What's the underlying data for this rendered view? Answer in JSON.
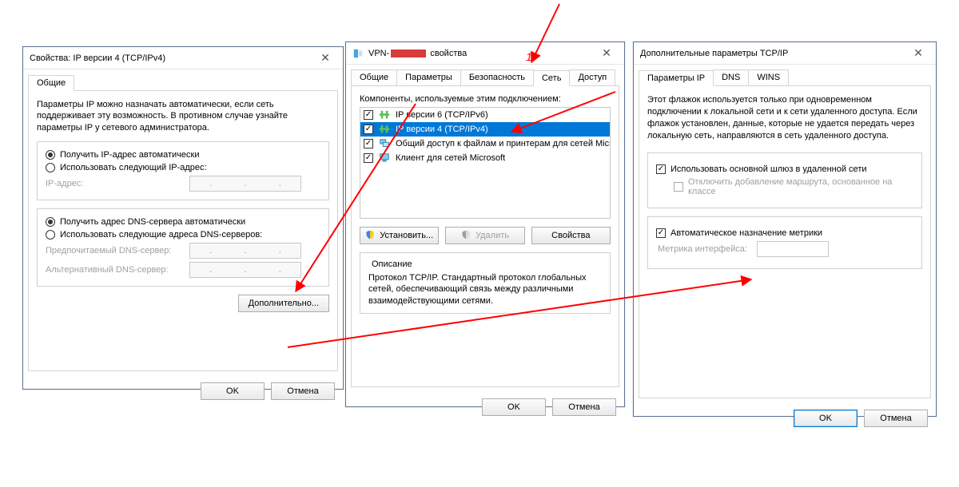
{
  "annotation_number": "1",
  "dialog1": {
    "title": "Свойства: IP версии 4 (TCP/IPv4)",
    "tab_general": "Общие",
    "intro": "Параметры IP можно назначать автоматически, если сеть поддерживает эту возможность. В противном случае узнайте параметры IP у сетевого администратора.",
    "radio_ip_auto": "Получить IP-адрес автоматически",
    "radio_ip_manual": "Использовать следующий IP-адрес:",
    "ip_address_label": "IP-адрес:",
    "radio_dns_auto": "Получить адрес DNS-сервера автоматически",
    "radio_dns_manual": "Использовать следующие адреса DNS-серверов:",
    "dns_pref_label": "Предпочитаемый DNS-сервер:",
    "dns_alt_label": "Альтернативный DNS-сервер:",
    "advanced_btn": "Дополнительно...",
    "ok": "OK",
    "cancel": "Отмена"
  },
  "dialog2": {
    "title_prefix": "VPN-",
    "title_suffix": "свойства",
    "tabs": {
      "general": "Общие",
      "params": "Параметры",
      "security": "Безопасность",
      "network": "Сеть",
      "access": "Доступ"
    },
    "components_label": "Компоненты, используемые этим подключением:",
    "items": [
      "IP версии 6 (TCP/IPv6)",
      "IP версии 4 (TCP/IPv4)",
      "Общий доступ к файлам и принтерам для сетей Micr...",
      "Клиент для сетей Microsoft"
    ],
    "install_btn": "Установить...",
    "remove_btn": "Удалить",
    "properties_btn": "Свойства",
    "desc_title": "Описание",
    "desc_text": "Протокол TCP/IP. Стандартный протокол глобальных сетей, обеспечивающий связь между различными взаимодействующими сетями.",
    "ok": "OK",
    "cancel": "Отмена"
  },
  "dialog3": {
    "title": "Дополнительные параметры TCP/IP",
    "tabs": {
      "ip": "Параметры IP",
      "dns": "DNS",
      "wins": "WINS"
    },
    "intro": "Этот флажок используется только при одновременном подключении к локальной сети и к сети удаленного доступа. Если флажок установлен, данные, которые не удается передать через локальную сеть, направляются в сеть удаленного доступа.",
    "gw_check": "Использовать основной шлюз в удаленной сети",
    "classroute_check": "Отключить добавление маршрута, основанное на классе",
    "autometric_check": "Автоматическое назначение метрики",
    "metric_label": "Метрика интерфейса:",
    "ok": "OK",
    "cancel": "Отмена"
  }
}
